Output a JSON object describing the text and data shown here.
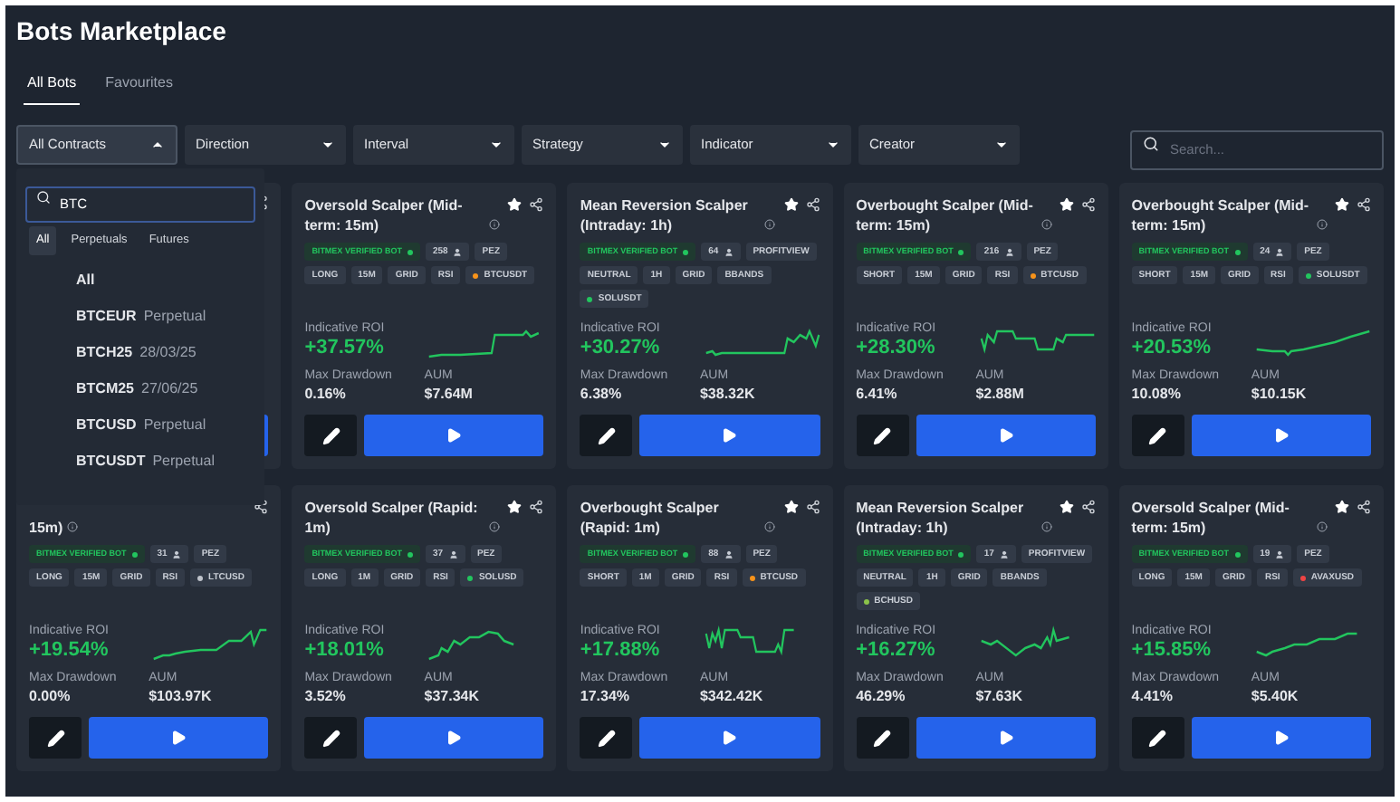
{
  "title": "Bots Marketplace",
  "tabs": [
    {
      "label": "All Bots",
      "selected": true
    },
    {
      "label": "Favourites",
      "selected": false
    }
  ],
  "filters": [
    {
      "label": "All Contracts",
      "expanded": true
    },
    {
      "label": "Direction",
      "expanded": false
    },
    {
      "label": "Interval",
      "expanded": false
    },
    {
      "label": "Strategy",
      "expanded": false
    },
    {
      "label": "Indicator",
      "expanded": false
    },
    {
      "label": "Creator",
      "expanded": false
    }
  ],
  "search": {
    "placeholder": "Search..."
  },
  "contract_menu": {
    "query": "BTC",
    "tabs": [
      {
        "label": "All",
        "selected": true
      },
      {
        "label": "Perpetuals",
        "selected": false
      },
      {
        "label": "Futures",
        "selected": false
      }
    ],
    "items": [
      {
        "symbol": "All"
      },
      {
        "symbol": "BTCEUR",
        "detail": "Perpetual"
      },
      {
        "symbol": "BTCH25",
        "detail": "28/03/25"
      },
      {
        "symbol": "BTCM25",
        "detail": "27/06/25"
      },
      {
        "symbol": "BTCUSD",
        "detail": "Perpetual"
      },
      {
        "symbol": "BTCUSDT",
        "detail": "Perpetual"
      }
    ]
  },
  "cards": [
    {
      "kind": "covered"
    },
    {
      "kind": "full",
      "title": "Oversold Scalper (Mid-term: 15m)",
      "verified": "BITMEX VERIFIED BOT",
      "users": "258",
      "creator": "PEZ",
      "tags": [
        {
          "label": "LONG"
        },
        {
          "label": "15M"
        },
        {
          "label": "GRID"
        },
        {
          "label": "RSI"
        },
        {
          "label": "BTCUSDT",
          "color": "#f7931a"
        }
      ],
      "roi_label": "Indicative ROI",
      "roi": "+37.57%",
      "drawdown_label": "Max Drawdown",
      "drawdown": "0.16%",
      "aum_label": "AUM",
      "aum": "$7.64M"
    },
    {
      "kind": "full",
      "title": "Mean Reversion Scalper (Intraday: 1h)",
      "verified": "BITMEX VERIFIED BOT",
      "users": "64",
      "creator": "PROFITVIEW",
      "tags": [
        {
          "label": "NEUTRAL"
        },
        {
          "label": "1H"
        },
        {
          "label": "GRID"
        },
        {
          "label": "BBANDS"
        },
        {
          "label": "SOLUSDT",
          "color": "#22c55e"
        }
      ],
      "roi_label": "Indicative ROI",
      "roi": "+30.27%",
      "drawdown_label": "Max Drawdown",
      "drawdown": "6.38%",
      "aum_label": "AUM",
      "aum": "$38.32K"
    },
    {
      "kind": "full",
      "title": "Overbought Scalper (Mid-term: 15m)",
      "verified": "BITMEX VERIFIED BOT",
      "users": "216",
      "creator": "PEZ",
      "tags": [
        {
          "label": "SHORT"
        },
        {
          "label": "15M"
        },
        {
          "label": "GRID"
        },
        {
          "label": "RSI"
        },
        {
          "label": "BTCUSD",
          "color": "#f7931a"
        }
      ],
      "roi_label": "Indicative ROI",
      "roi": "+28.30%",
      "drawdown_label": "Max Drawdown",
      "drawdown": "6.41%",
      "aum_label": "AUM",
      "aum": "$2.88M"
    },
    {
      "kind": "full",
      "title": "Overbought Scalper (Mid-term: 15m)",
      "verified": "BITMEX VERIFIED BOT",
      "users": "24",
      "creator": "PEZ",
      "tags": [
        {
          "label": "SHORT"
        },
        {
          "label": "15M"
        },
        {
          "label": "GRID"
        },
        {
          "label": "RSI"
        },
        {
          "label": "SOLUSDT",
          "color": "#22c55e"
        }
      ],
      "roi_label": "Indicative ROI",
      "roi": "+20.53%",
      "drawdown_label": "Max Drawdown",
      "drawdown": "10.08%",
      "aum_label": "AUM",
      "aum": "$10.15K"
    },
    {
      "kind": "covered_top",
      "title": "15m)",
      "verified": "BITMEX VERIFIED BOT",
      "users": "31",
      "creator": "PEZ",
      "tags": [
        {
          "label": "LONG"
        },
        {
          "label": "15M"
        },
        {
          "label": "GRID"
        },
        {
          "label": "RSI"
        },
        {
          "label": "LTCUSD",
          "color": "#c0c4cc"
        }
      ],
      "roi_label": "Indicative ROI",
      "roi": "+19.54%",
      "drawdown_label": "Max Drawdown",
      "drawdown": "0.00%",
      "aum_label": "AUM",
      "aum": "$103.97K"
    },
    {
      "kind": "full",
      "title": "Oversold Scalper (Rapid: 1m)",
      "verified": "BITMEX VERIFIED BOT",
      "users": "37",
      "creator": "PEZ",
      "tags": [
        {
          "label": "LONG"
        },
        {
          "label": "1M"
        },
        {
          "label": "GRID"
        },
        {
          "label": "RSI"
        },
        {
          "label": "SOLUSD",
          "color": "#22c55e"
        }
      ],
      "roi_label": "Indicative ROI",
      "roi": "+18.01%",
      "drawdown_label": "Max Drawdown",
      "drawdown": "3.52%",
      "aum_label": "AUM",
      "aum": "$37.34K"
    },
    {
      "kind": "full",
      "title": "Overbought Scalper (Rapid: 1m)",
      "verified": "BITMEX VERIFIED BOT",
      "users": "88",
      "creator": "PEZ",
      "tags": [
        {
          "label": "SHORT"
        },
        {
          "label": "1M"
        },
        {
          "label": "GRID"
        },
        {
          "label": "RSI"
        },
        {
          "label": "BTCUSD",
          "color": "#f7931a"
        }
      ],
      "roi_label": "Indicative ROI",
      "roi": "+17.88%",
      "drawdown_label": "Max Drawdown",
      "drawdown": "17.34%",
      "aum_label": "AUM",
      "aum": "$342.42K"
    },
    {
      "kind": "full",
      "title": "Mean Reversion Scalper (Intraday: 1h)",
      "verified": "BITMEX VERIFIED BOT",
      "users": "17",
      "creator": "PROFITVIEW",
      "tags": [
        {
          "label": "NEUTRAL"
        },
        {
          "label": "1H"
        },
        {
          "label": "GRID"
        },
        {
          "label": "BBANDS"
        },
        {
          "label": "BCHUSD",
          "color": "#8bc34a"
        }
      ],
      "roi_label": "Indicative ROI",
      "roi": "+16.27%",
      "drawdown_label": "Max Drawdown",
      "drawdown": "46.29%",
      "aum_label": "AUM",
      "aum": "$7.63K"
    },
    {
      "kind": "full",
      "title": "Oversold Scalper (Mid-term: 15m)",
      "verified": "BITMEX VERIFIED BOT",
      "users": "19",
      "creator": "PEZ",
      "tags": [
        {
          "label": "LONG"
        },
        {
          "label": "15M"
        },
        {
          "label": "GRID"
        },
        {
          "label": "RSI"
        },
        {
          "label": "AVAXUSD",
          "color": "#ef4444"
        }
      ],
      "roi_label": "Indicative ROI",
      "roi": "+15.85%",
      "drawdown_label": "Max Drawdown",
      "drawdown": "4.41%",
      "aum_label": "AUM",
      "aum": "$5.40K"
    }
  ]
}
